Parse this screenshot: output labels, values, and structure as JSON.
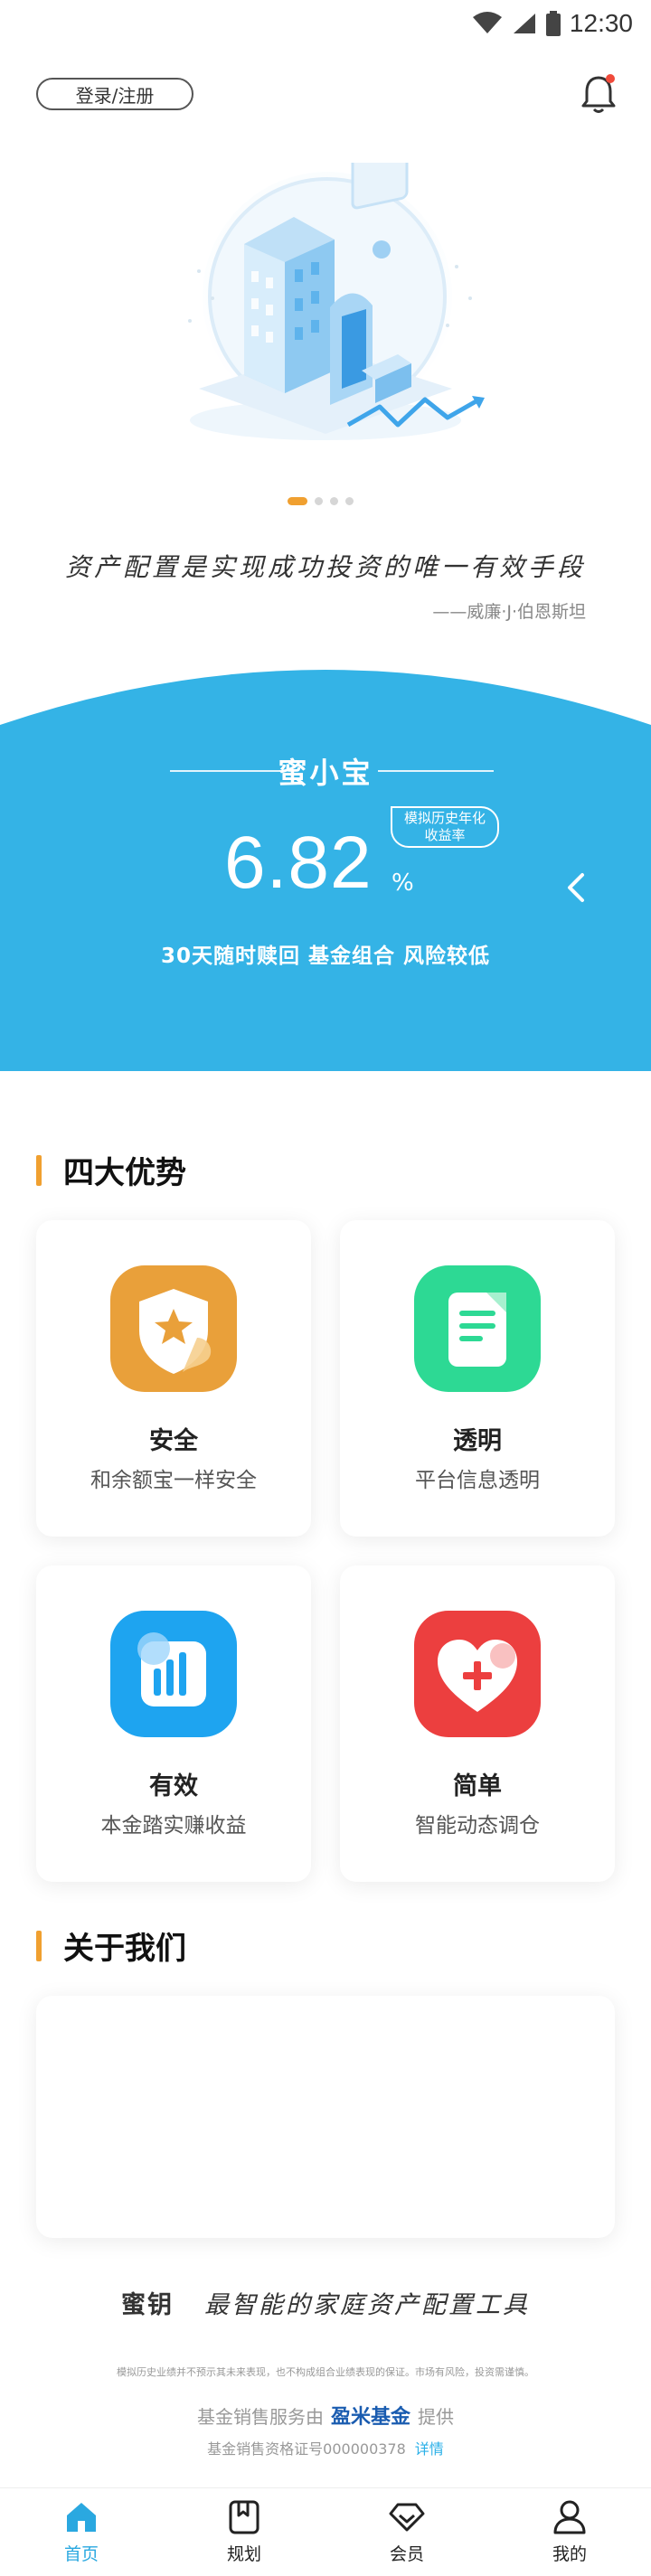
{
  "status_bar": {
    "time": "12:30"
  },
  "header": {
    "login_label": "登录/注册"
  },
  "carousel": {
    "pages": 4,
    "active_index": 0
  },
  "quote": {
    "text": "资产配置是实现成功投资的唯一有效手段",
    "author": "——威廉·J·伯恩斯坦"
  },
  "product": {
    "name": "蜜小宝",
    "rate_value": "6.82",
    "rate_unit": "%",
    "rate_tag_line1": "模拟历史年化",
    "rate_tag_line2": "收益率",
    "description": "30天随时赎回  基金组合  风险较低"
  },
  "advantages": {
    "title": "四大优势",
    "items": [
      {
        "title": "安全",
        "desc": "和余额宝一样安全",
        "icon": "shield-star-icon",
        "color": "#e9a03a"
      },
      {
        "title": "透明",
        "desc": "平台信息透明",
        "icon": "document-icon",
        "color": "#2dd994"
      },
      {
        "title": "有效",
        "desc": "本金踏实赚收益",
        "icon": "bar-chart-icon",
        "color": "#1ea4f0"
      },
      {
        "title": "简单",
        "desc": "智能动态调仓",
        "icon": "heart-plus-icon",
        "color": "#ec3f3f"
      }
    ]
  },
  "about": {
    "title": "关于我们"
  },
  "footer": {
    "brand_name": "蜜钥",
    "slogan": "最智能的家庭资产配置工具",
    "disclaimer": "模拟历史业绩并不预示其未来表现，也不构成组合业绩表现的保证。市场有风险，投资需谨慎。",
    "service_prefix": "基金销售服务由",
    "partner_name": "盈米基金",
    "service_suffix": "提供",
    "license_text": "基金销售资格证号000000378",
    "license_link": "详情"
  },
  "tabbar": {
    "items": [
      {
        "label": "首页",
        "icon": "home-icon",
        "active": true
      },
      {
        "label": "规划",
        "icon": "planning-icon",
        "active": false
      },
      {
        "label": "会员",
        "icon": "diamond-icon",
        "active": false
      },
      {
        "label": "我的",
        "icon": "user-icon",
        "active": false
      }
    ]
  },
  "colors": {
    "accent": "#2aa8e0",
    "brand_blue": "#34b3e6",
    "highlight": "#f0a030"
  }
}
